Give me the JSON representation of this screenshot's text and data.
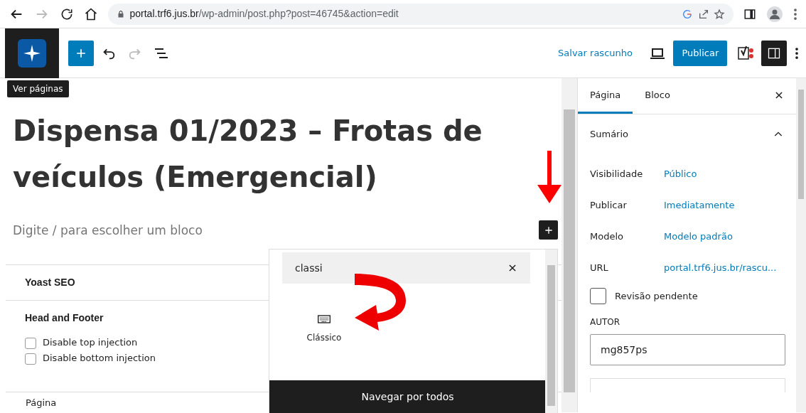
{
  "browser": {
    "url_host": "portal.trf6.jus.br",
    "url_path": "/wp-admin/post.php?post=46745&action=edit"
  },
  "toolbar": {
    "save_draft": "Salvar rascunho",
    "publish": "Publicar"
  },
  "tooltip": "Ver páginas",
  "post": {
    "title": "Dispensa 01/2023 – Frotas de veículos (Emergencial)",
    "placeholder": "Digite / para escolher um bloco"
  },
  "meta_boxes": [
    {
      "title": "Yoast SEO"
    },
    {
      "title": "Head and Footer",
      "options": [
        {
          "label": "Disable top injection",
          "checked": false
        },
        {
          "label": "Disable bottom injection",
          "checked": false
        }
      ]
    }
  ],
  "bottom_label": "Página",
  "inserter": {
    "search": "classi",
    "results": [
      {
        "label": "Clássico"
      }
    ],
    "browse_all": "Navegar por todos"
  },
  "sidebar": {
    "tabs": [
      {
        "label": "Página",
        "selected": true
      },
      {
        "label": "Bloco",
        "selected": false
      }
    ],
    "panel": {
      "title": "Sumário",
      "expanded": true,
      "rows": [
        {
          "label": "Visibilidade",
          "value": "Público"
        },
        {
          "label": "Publicar",
          "value": "Imediatamente"
        },
        {
          "label": "Modelo",
          "value": "Modelo padrão"
        },
        {
          "label": "URL",
          "value": "portal.trf6.jus.br/rascu..."
        }
      ],
      "pending_review": {
        "label": "Revisão pendente",
        "checked": false
      },
      "author_label": "AUTOR",
      "author": "mg857ps"
    }
  }
}
